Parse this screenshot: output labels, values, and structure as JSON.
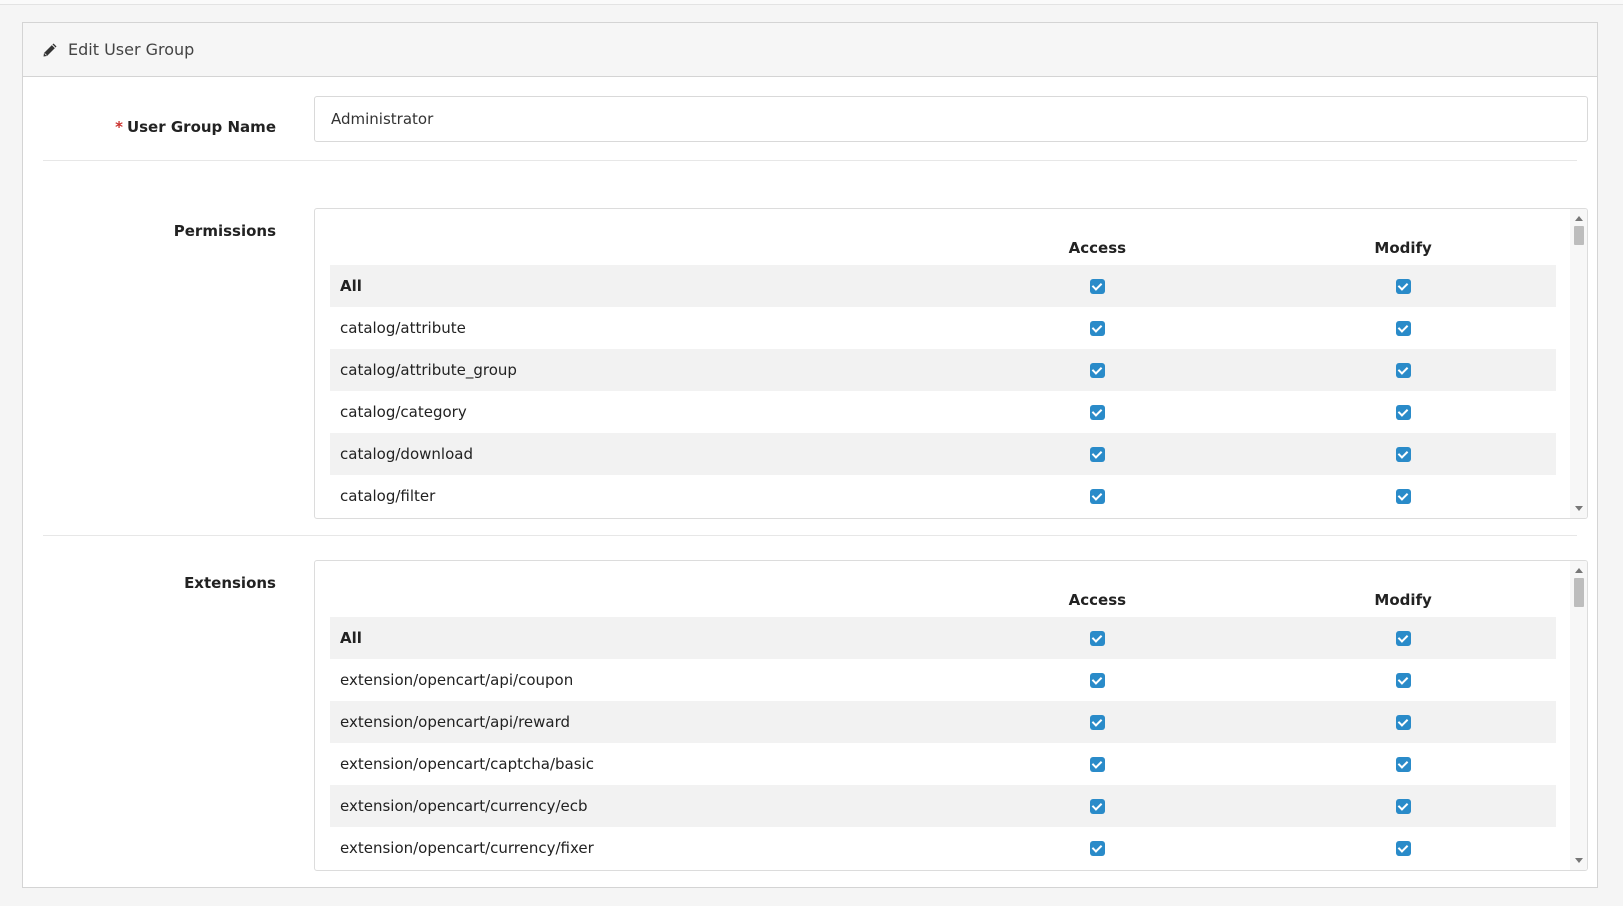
{
  "header": {
    "title": "Edit User Group",
    "icon": "pencil-icon"
  },
  "form": {
    "name_label": "User Group Name",
    "required_mark": "*",
    "name_value": "Administrator"
  },
  "permissions": {
    "label": "Permissions",
    "col_access": "Access",
    "col_modify": "Modify",
    "rows": [
      {
        "name": "All",
        "access": true,
        "modify": true
      },
      {
        "name": "catalog/attribute",
        "access": true,
        "modify": true
      },
      {
        "name": "catalog/attribute_group",
        "access": true,
        "modify": true
      },
      {
        "name": "catalog/category",
        "access": true,
        "modify": true
      },
      {
        "name": "catalog/download",
        "access": true,
        "modify": true
      },
      {
        "name": "catalog/filter",
        "access": true,
        "modify": true
      }
    ]
  },
  "extensions": {
    "label": "Extensions",
    "col_access": "Access",
    "col_modify": "Modify",
    "rows": [
      {
        "name": "All",
        "access": true,
        "modify": true
      },
      {
        "name": "extension/opencart/api/coupon",
        "access": true,
        "modify": true
      },
      {
        "name": "extension/opencart/api/reward",
        "access": true,
        "modify": true
      },
      {
        "name": "extension/opencart/captcha/basic",
        "access": true,
        "modify": true
      },
      {
        "name": "extension/opencart/currency/ecb",
        "access": true,
        "modify": true
      },
      {
        "name": "extension/opencart/currency/fixer",
        "access": true,
        "modify": true
      }
    ]
  },
  "colors": {
    "checkbox": "#2a8bc9",
    "required": "#c9302c"
  }
}
